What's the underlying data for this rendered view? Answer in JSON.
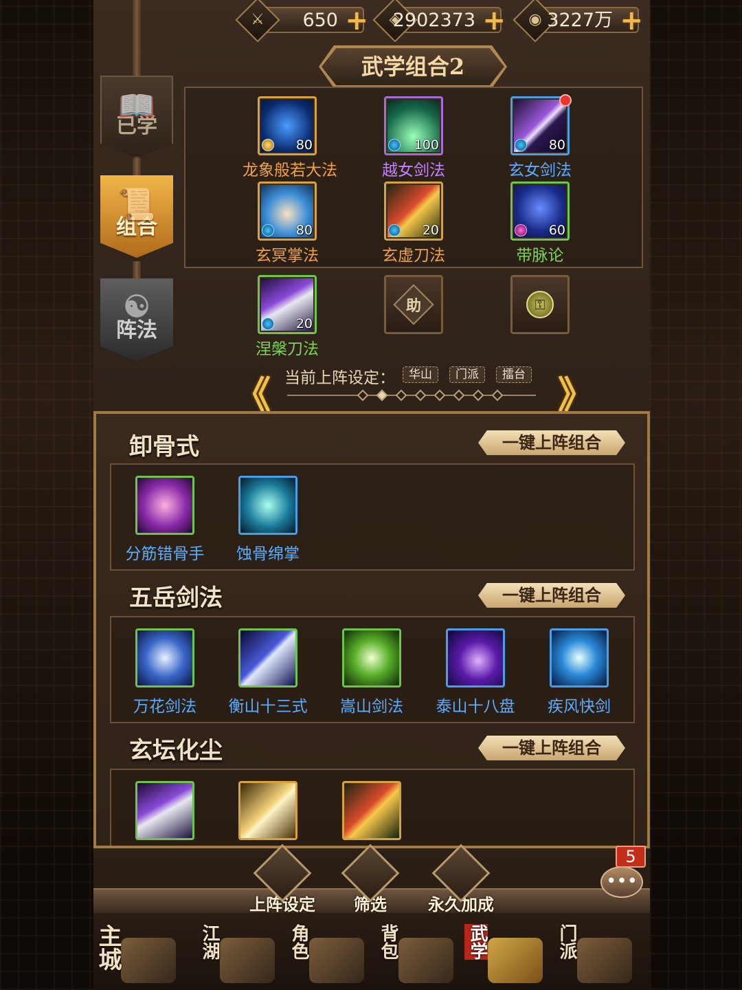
{
  "currency": [
    {
      "icon": "token-icon",
      "symbol": "⚔",
      "value": "650"
    },
    {
      "icon": "coin-icon",
      "symbol": "◈",
      "value": "2902373"
    },
    {
      "icon": "silver-icon",
      "symbol": "◉",
      "value": "3227万"
    }
  ],
  "side_tabs": {
    "learned": "已学",
    "combo": "组合",
    "array": "阵法"
  },
  "header": {
    "title": "武学组合2"
  },
  "combo_slots": [
    {
      "name": "龙象般若大法",
      "level": "80",
      "gem": "gold"
    },
    {
      "name": "越女剑法",
      "level": "100",
      "gem": "blue"
    },
    {
      "name": "玄女剑法",
      "level": "80",
      "gem": "blue",
      "badge": true
    },
    {
      "name": "玄冥掌法",
      "level": "80",
      "gem": "blue"
    },
    {
      "name": "玄虚刀法",
      "level": "20",
      "gem": "blue"
    },
    {
      "name": "带脉论",
      "level": "60",
      "gem": "purple"
    },
    {
      "name": "涅槃刀法",
      "level": "20",
      "gem": "blue"
    }
  ],
  "assist_slot": {
    "label": "助"
  },
  "locked_slot": {
    "symbol": "⚿"
  },
  "current_setting": {
    "label": "当前上阵设定：",
    "tags": [
      "华山",
      "门派",
      "擂台"
    ],
    "prev_arrow": "《",
    "next_arrow": "》"
  },
  "groups": [
    {
      "title": "卸骨式",
      "button": "一键上阵组合",
      "skills": [
        "分筋错骨手",
        "蚀骨绵掌"
      ]
    },
    {
      "title": "五岳剑法",
      "button": "一键上阵组合",
      "skills": [
        "万花剑法",
        "衡山十三式",
        "嵩山剑法",
        "泰山十八盘",
        "疾风快剑"
      ]
    },
    {
      "title": "玄坛化尘",
      "button": "一键上阵组合",
      "skills": [
        "",
        "",
        ""
      ]
    }
  ],
  "actions": {
    "deploy": "上阵设定",
    "filter": "筛选",
    "permanent": "永久加成"
  },
  "chat": {
    "count": "5",
    "symbol": "•••"
  },
  "nav": [
    {
      "label": "主城",
      "active": false
    },
    {
      "label": "江湖",
      "active": false
    },
    {
      "label": "角色",
      "active": false
    },
    {
      "label": "背包",
      "active": false
    },
    {
      "label": "武学",
      "active": true
    },
    {
      "label": "门派",
      "active": false
    }
  ],
  "colors": {
    "accent_gold": "#f0b94c",
    "panel_border": "#a37a44",
    "active_nav": "#b8281a"
  }
}
